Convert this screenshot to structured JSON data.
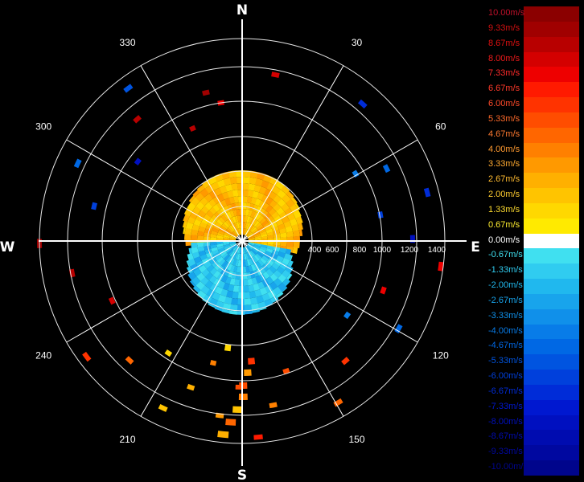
{
  "radar": {
    "compass": {
      "north": "N",
      "east": "E",
      "south": "S",
      "west": "W"
    },
    "azimuth_labels": [
      {
        "angle": 30,
        "text": "30"
      },
      {
        "angle": 60,
        "text": "60"
      },
      {
        "angle": 120,
        "text": "120"
      },
      {
        "angle": 150,
        "text": "150"
      },
      {
        "angle": 210,
        "text": "210"
      },
      {
        "angle": 240,
        "text": "240"
      },
      {
        "angle": 300,
        "text": "300"
      },
      {
        "angle": 330,
        "text": "330"
      }
    ],
    "range_labels": [
      "400",
      "600",
      "800",
      "1000",
      "1200",
      "1400"
    ],
    "range_max": 1400
  },
  "legend": {
    "title": "",
    "items": [
      {
        "label": "10.00m/s",
        "color": "#8b0000",
        "text_color": "#c0102a"
      },
      {
        "label": "9.33m/s",
        "color": "#a00000",
        "text_color": "#d01010"
      },
      {
        "label": "8.67m/s",
        "color": "#b80000",
        "text_color": "#e01010"
      },
      {
        "label": "8.00m/s",
        "color": "#d40000",
        "text_color": "#ee1a1a"
      },
      {
        "label": "7.33m/s",
        "color": "#ee0000",
        "text_color": "#ff2a2a"
      },
      {
        "label": "6.67m/s",
        "color": "#ff1a00",
        "text_color": "#ff3a2a"
      },
      {
        "label": "6.00m/s",
        "color": "#ff3300",
        "text_color": "#ff4a2a"
      },
      {
        "label": "5.33m/s",
        "color": "#ff4d00",
        "text_color": "#ff6a2a"
      },
      {
        "label": "4.67m/s",
        "color": "#ff6600",
        "text_color": "#ff7a30"
      },
      {
        "label": "4.00m/s",
        "color": "#ff8000",
        "text_color": "#ff9a30"
      },
      {
        "label": "3.33m/s",
        "color": "#ff9900",
        "text_color": "#ffaa30"
      },
      {
        "label": "2.67m/s",
        "color": "#ffb000",
        "text_color": "#ffbb30"
      },
      {
        "label": "2.00m/s",
        "color": "#ffc400",
        "text_color": "#ffcc30"
      },
      {
        "label": "1.33m/s",
        "color": "#ffd800",
        "text_color": "#ffdd30"
      },
      {
        "label": "0.67m/s",
        "color": "#ffea00",
        "text_color": "#ffee30"
      },
      {
        "label": "0.00m/s",
        "color": "#ffffff",
        "text_color": "#ffffff"
      },
      {
        "label": "-0.67m/s",
        "color": "#40e0f0",
        "text_color": "#40e0f0"
      },
      {
        "label": "-1.33m/s",
        "color": "#30ccf0",
        "text_color": "#30ccf0"
      },
      {
        "label": "-2.00m/s",
        "color": "#20b8ee",
        "text_color": "#20b8ee"
      },
      {
        "label": "-2.67m/s",
        "color": "#18a4ec",
        "text_color": "#18a4ec"
      },
      {
        "label": "-3.33m/s",
        "color": "#1090ea",
        "text_color": "#1090ea"
      },
      {
        "label": "-4.00m/s",
        "color": "#087ce8",
        "text_color": "#087ce8"
      },
      {
        "label": "-4.67m/s",
        "color": "#0068e4",
        "text_color": "#0068e4"
      },
      {
        "label": "-5.33m/s",
        "color": "#0054e0",
        "text_color": "#0054e0"
      },
      {
        "label": "-6.00m/s",
        "color": "#0040dc",
        "text_color": "#0040dc"
      },
      {
        "label": "-6.67m/s",
        "color": "#002cd8",
        "text_color": "#002cd8"
      },
      {
        "label": "-7.33m/s",
        "color": "#0018d0",
        "text_color": "#0018d0"
      },
      {
        "label": "-8.00m/s",
        "color": "#0010c0",
        "text_color": "#0010c0"
      },
      {
        "label": "-8.67m/s",
        "color": "#000cb0",
        "text_color": "#000cb0"
      },
      {
        "label": "-9.33m/s",
        "color": "#0008a0",
        "text_color": "#0008a0"
      },
      {
        "label": "-10.00m/s",
        "color": "#00058c",
        "text_color": "#00058c"
      }
    ]
  }
}
